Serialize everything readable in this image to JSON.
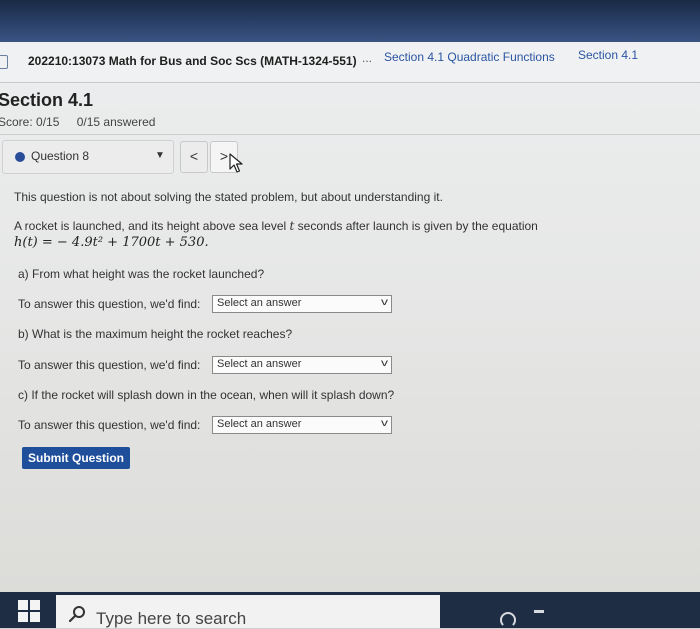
{
  "header": {
    "course_title": "202210:13073 Math for Bus and Soc Scs (MATH-1324-551)",
    "breadcrumb_ellipsis": "...",
    "breadcrumb_link": "Section 4.1 Quadratic Functions",
    "breadcrumb_current": "Section 4.1"
  },
  "section": {
    "title": "Section 4.1",
    "score": "Score: 0/15",
    "answered": "0/15 answered"
  },
  "question_nav": {
    "selected_question": "Question 8",
    "prev_symbol": "<",
    "next_symbol": ">"
  },
  "question": {
    "intro": "This question is not about solving the stated problem, but about understanding it.",
    "problem_before_t": "A rocket is launched, and its height above sea level ",
    "problem_var": "t",
    "problem_after_t": " seconds after launch is given by the equation",
    "equation": "h(t) = − 4.9t² + 1700t + 530.",
    "part_a": "a) From what height was the rocket launched?",
    "part_b": "b) What is the maximum height the rocket reaches?",
    "part_c": "c) If the rocket will splash down in the ocean, when will it splash down?",
    "answer_prompt": "To answer this question, we'd find:",
    "select_placeholder": "Select an answer"
  },
  "submit": {
    "label": "Submit Question"
  },
  "taskbar": {
    "search_placeholder": "Type here to search"
  },
  "icons": {
    "question_status": "circle-icon",
    "select_caret": "chevron-down-icon",
    "search": "search-icon",
    "start": "windows-logo-icon"
  },
  "colors": {
    "accent": "#1f4e9b",
    "link": "#2b55a3"
  }
}
